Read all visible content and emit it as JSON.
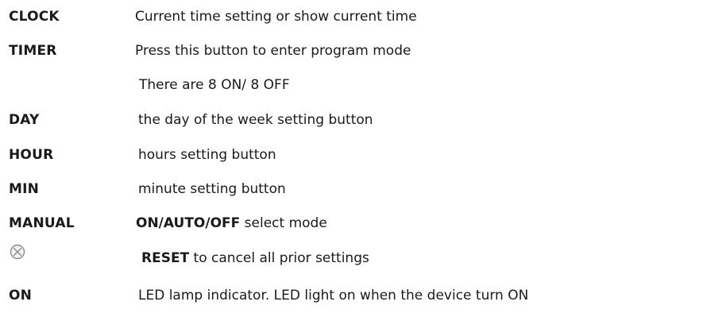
{
  "entries": [
    {
      "term": "CLOCK",
      "description": "Current time setting or show current time"
    },
    {
      "term": "TIMER",
      "description": "Press this button to enter program mode"
    },
    {
      "term": "",
      "description": "There are 8 ON/ 8 OFF"
    },
    {
      "term": "DAY",
      "description": "the day of the week setting button"
    },
    {
      "term": "HOUR",
      "description": "hours setting button"
    },
    {
      "term": "MIN",
      "description": "minute setting button"
    },
    {
      "term": "MANUAL",
      "description_bold": "ON/AUTO/OFF",
      "description": " select mode"
    },
    {
      "icon": "reset-circle-x-icon",
      "description_bold": "RESET",
      "description": " to cancel all prior settings"
    },
    {
      "term": "ON",
      "description": "LED lamp indicator. LED light on when the device turn ON"
    }
  ]
}
